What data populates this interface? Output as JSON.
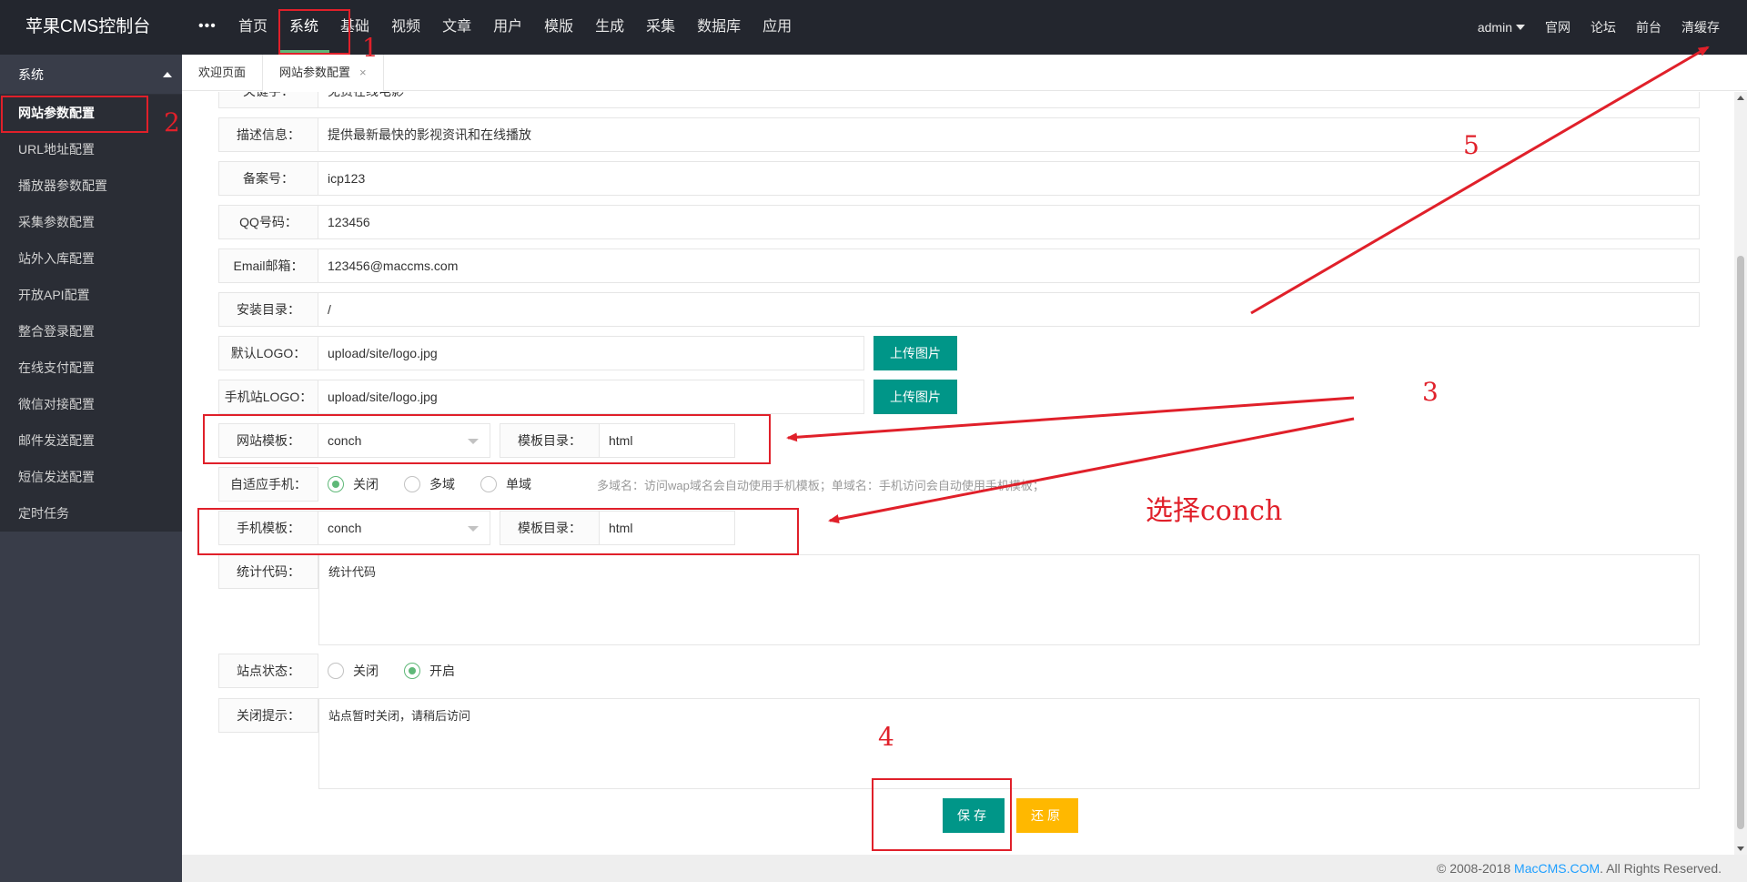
{
  "header": {
    "logo": "苹果CMS控制台",
    "more": "•••",
    "nav": [
      "首页",
      "系统",
      "基础",
      "视频",
      "文章",
      "用户",
      "模版",
      "生成",
      "采集",
      "数据库",
      "应用"
    ],
    "active_nav": "系统",
    "right": {
      "user": "admin",
      "links": [
        "官网",
        "论坛",
        "前台",
        "清缓存"
      ]
    }
  },
  "sidebar": {
    "section": "系统",
    "items": [
      "网站参数配置",
      "URL地址配置",
      "播放器参数配置",
      "采集参数配置",
      "站外入库配置",
      "开放API配置",
      "整合登录配置",
      "在线支付配置",
      "微信对接配置",
      "邮件发送配置",
      "短信发送配置",
      "定时任务"
    ],
    "active": "网站参数配置"
  },
  "tabs": {
    "items": [
      "欢迎页面",
      "网站参数配置"
    ],
    "close": "×"
  },
  "form": {
    "keywords": {
      "label": "关键字：",
      "value": "免费在线电影"
    },
    "description": {
      "label": "描述信息：",
      "value": "提供最新最快的影视资讯和在线播放"
    },
    "icp": {
      "label": "备案号：",
      "value": "icp123"
    },
    "qq": {
      "label": "QQ号码：",
      "value": "123456"
    },
    "email": {
      "label": "Email邮箱：",
      "value": "123456@maccms.com"
    },
    "install_dir": {
      "label": "安装目录：",
      "value": "/"
    },
    "logo": {
      "label": "默认LOGO：",
      "value": "upload/site/logo.jpg",
      "button": "上传图片"
    },
    "mobile_logo": {
      "label": "手机站LOGO：",
      "value": "upload/site/logo.jpg",
      "button": "上传图片"
    },
    "template": {
      "label": "网站模板：",
      "value": "conch",
      "dir_label": "模板目录：",
      "dir_value": "html"
    },
    "adaptive": {
      "label": "自适应手机：",
      "options": [
        "关闭",
        "多域",
        "单域"
      ],
      "selected": "关闭",
      "hint": "多域名：访问wap域名会自动使用手机模板；单域名：手机访问会自动使用手机模板；"
    },
    "mobile_template": {
      "label": "手机模板：",
      "value": "conch",
      "dir_label": "模板目录：",
      "dir_value": "html"
    },
    "stats_code": {
      "label": "统计代码：",
      "value": "统计代码"
    },
    "site_status": {
      "label": "站点状态：",
      "options": [
        "关闭",
        "开启"
      ],
      "selected": "开启"
    },
    "close_tip": {
      "label": "关闭提示：",
      "value": "站点暂时关闭，请稍后访问"
    },
    "save": "保存",
    "reset": "还原"
  },
  "footer": {
    "prefix": "© 2008-2018 ",
    "brand": "MacCMS.COM",
    "suffix": ". All Rights Reserved."
  },
  "annotations": {
    "n1": "1",
    "n2": "2",
    "n3": "3",
    "n4": "4",
    "n5": "5",
    "note": "选择conch",
    "color": "#e0202a"
  },
  "colors": {
    "header_bg": "#23262e",
    "sidebar_bg": "#393d49",
    "primary": "#009688",
    "warm": "#ffb800",
    "active_line": "#5fb878",
    "link": "#1e9fff"
  }
}
